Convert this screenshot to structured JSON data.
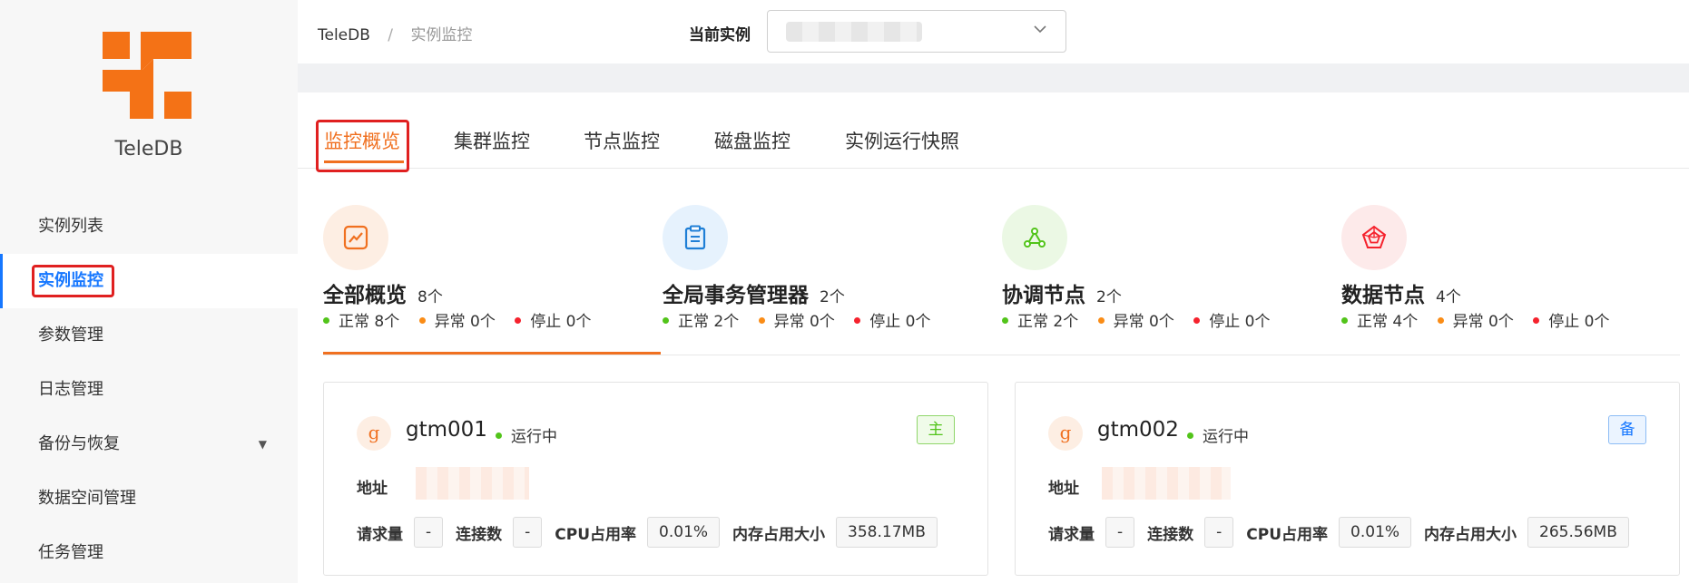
{
  "sidebar": {
    "brand": "TeleDB",
    "items": [
      {
        "label": "实例列表"
      },
      {
        "label": "实例监控"
      },
      {
        "label": "参数管理"
      },
      {
        "label": "日志管理"
      },
      {
        "label": "备份与恢复"
      },
      {
        "label": "数据空间管理"
      },
      {
        "label": "任务管理"
      }
    ]
  },
  "header": {
    "breadcrumb": [
      "TeleDB",
      "/",
      "实例监控"
    ],
    "instance_label": "当前实例"
  },
  "tabs": [
    "监控概览",
    "集群监控",
    "节点监控",
    "磁盘监控",
    "实例运行快照"
  ],
  "summary": [
    {
      "title": "全部概览",
      "count": "8个",
      "normal": "正常 8个",
      "abnormal": "异常 0个",
      "stopped": "停止 0个",
      "icon": "trend-icon"
    },
    {
      "title": "全局事务管理器",
      "count": "2个",
      "normal": "正常 2个",
      "abnormal": "异常 0个",
      "stopped": "停止 0个",
      "icon": "clipboard-icon"
    },
    {
      "title": "协调节点",
      "count": "2个",
      "normal": "正常 2个",
      "abnormal": "异常 0个",
      "stopped": "停止 0个",
      "icon": "nodes-icon"
    },
    {
      "title": "数据节点",
      "count": "4个",
      "normal": "正常 4个",
      "abnormal": "异常 0个",
      "stopped": "停止 0个",
      "icon": "pentagon-icon"
    }
  ],
  "nodes": [
    {
      "avatar": "g",
      "name": "gtm001",
      "status": "运行中",
      "role": "主",
      "addr_label": "地址",
      "req_label": "请求量",
      "req": "-",
      "conn_label": "连接数",
      "conn": "-",
      "cpu_label": "CPU占用率",
      "cpu": "0.01%",
      "mem_label": "内存占用大小",
      "mem": "358.17MB"
    },
    {
      "avatar": "g",
      "name": "gtm002",
      "status": "运行中",
      "role": "备",
      "addr_label": "地址",
      "req_label": "请求量",
      "req": "-",
      "conn_label": "连接数",
      "conn": "-",
      "cpu_label": "CPU占用率",
      "cpu": "0.01%",
      "mem_label": "内存占用大小",
      "mem": "265.56MB"
    }
  ],
  "colors": {
    "accent": "#f07020",
    "active_nav": "#1677ff",
    "normal": "#52c41a",
    "abnormal": "#fa8c16",
    "stopped": "#f5222d",
    "highlight_box": "#e02020"
  }
}
